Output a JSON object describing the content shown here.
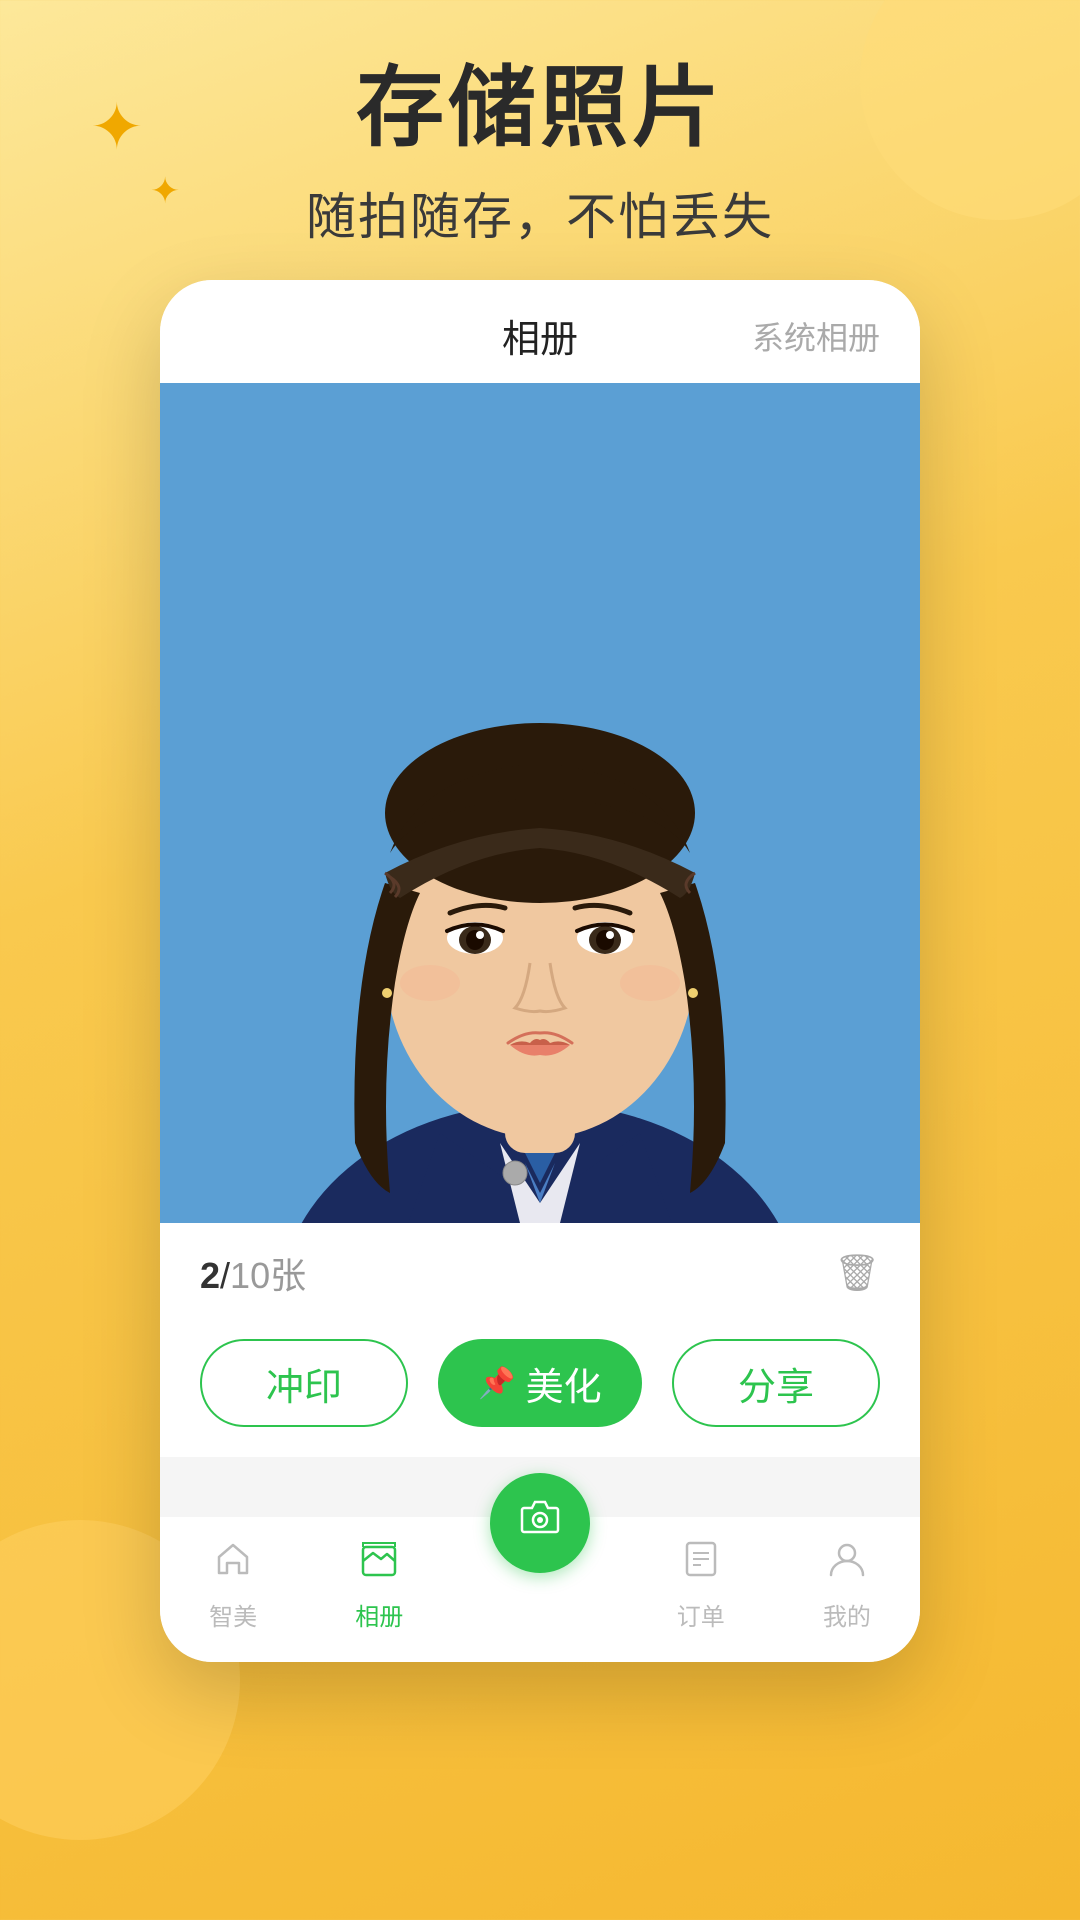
{
  "background": {
    "color_start": "#fde89a",
    "color_end": "#f5b830"
  },
  "header": {
    "main_title": "存储照片",
    "sub_title": "随拍随存，不怕丢失"
  },
  "phone": {
    "tab_album": "相册",
    "tab_system": "系统相册",
    "photo_current": "2",
    "photo_separator": "/",
    "photo_total": "10",
    "photo_unit": "张",
    "btn_print": "冲印",
    "btn_beautify": "美化",
    "btn_share": "分享",
    "nav_items": [
      {
        "label": "智美",
        "icon": "home",
        "active": false
      },
      {
        "label": "相册",
        "icon": "album",
        "active": true
      },
      {
        "label": "",
        "icon": "camera",
        "active": false,
        "is_camera": true
      },
      {
        "label": "订单",
        "icon": "order",
        "active": false
      },
      {
        "label": "我的",
        "icon": "profile",
        "active": false
      }
    ]
  },
  "decorations": {
    "star_large": "✦",
    "star_small": "✦"
  }
}
